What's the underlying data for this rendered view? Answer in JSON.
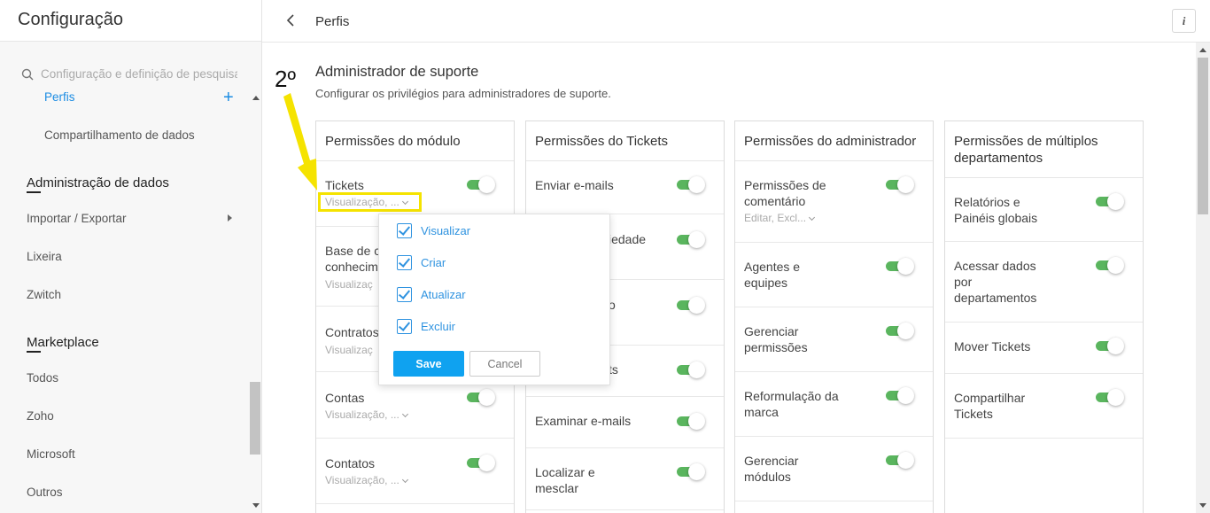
{
  "sidebar": {
    "title": "Configuração",
    "search_placeholder": "Configuração e definição de pesquisa",
    "items": [
      {
        "label": "Perfis",
        "active": true
      },
      {
        "label": "Compartilhamento de dados"
      }
    ],
    "section_data_admin": "Administração de dados",
    "data_admin_items": [
      "Importar / Exportar",
      "Lixeira",
      "Zwitch"
    ],
    "section_marketplace": "Marketplace",
    "marketplace_items": [
      "Todos",
      "Zoho",
      "Microsoft",
      "Outros"
    ]
  },
  "header": {
    "title": "Perfis",
    "info_icon": "i"
  },
  "profile": {
    "name": "Administrador de suporte",
    "description": "Configurar os privilégios para administradores de suporte."
  },
  "annotation": {
    "step_label": "2º",
    "color": "#f5e300"
  },
  "cards": {
    "module": {
      "title": "Permissões do módulo",
      "rows": [
        {
          "label": "Tickets",
          "sub": "Visualização, ..."
        },
        {
          "label": "Base de conhecimento",
          "label_visible_1": "Base de c",
          "label_visible_2": "conhecim",
          "sub": "Visualizaç"
        },
        {
          "label": "Contratos",
          "sub": "Visualizaç"
        },
        {
          "label": "Contas",
          "sub": "Visualização, ..."
        },
        {
          "label": "Contatos",
          "sub": "Visualização, ..."
        }
      ]
    },
    "tickets": {
      "title": "Permissões do Tickets",
      "rows": [
        {
          "label": "Enviar e-mails"
        },
        {
          "label": "iedade"
        },
        {
          "label": "o"
        },
        {
          "label": "ts"
        },
        {
          "label": "Examinar e-mails"
        },
        {
          "label": "Localizar e mesclar",
          "l1": "Localizar e",
          "l2": "mesclar"
        }
      ]
    },
    "admin": {
      "title": "Permissões do administrador",
      "rows": [
        {
          "l1": "Permissões de",
          "l2": "comentário",
          "sub": "Editar, Excl..."
        },
        {
          "l1": "Agentes e",
          "l2": "equipes"
        },
        {
          "l1": "Gerenciar",
          "l2": "permissões"
        },
        {
          "l1": "Reformulação da",
          "l2": "marca"
        },
        {
          "l1": "Gerenciar",
          "l2": "módulos"
        }
      ]
    },
    "multi": {
      "title_1": "Permissões de múltiplos",
      "title_2": "departamentos",
      "rows": [
        {
          "l1": "Relatórios e",
          "l2": "Painéis globais"
        },
        {
          "l1": "Acessar dados",
          "l2": "por",
          "l3": "departamentos"
        },
        {
          "l1": "Mover Tickets"
        },
        {
          "l1": "Compartilhar",
          "l2": "Tickets"
        }
      ]
    }
  },
  "dropdown": {
    "options": [
      "Visualizar",
      "Criar",
      "Atualizar",
      "Excluir"
    ],
    "save_label": "Save",
    "cancel_label": "Cancel"
  },
  "colors": {
    "accent": "#1b8ce3",
    "toggle_on": "#5ab55e",
    "save": "#0fa2f0",
    "highlight": "#f5e300"
  }
}
